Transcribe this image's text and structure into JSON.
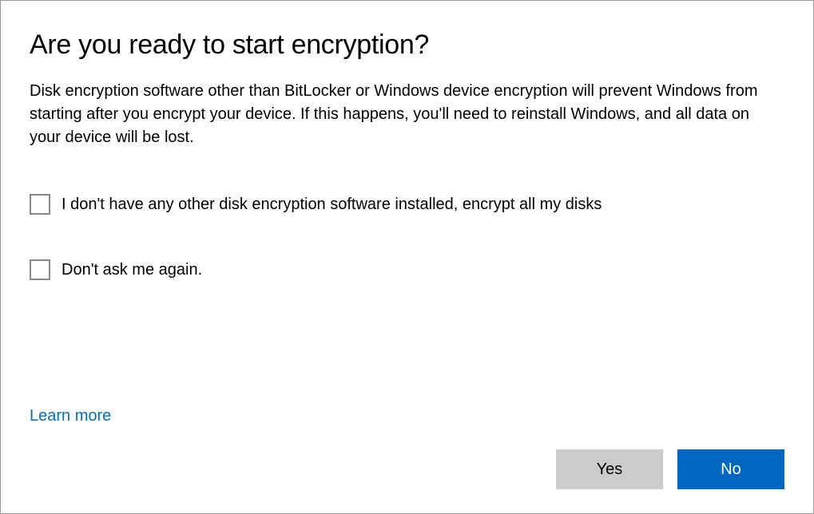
{
  "dialog": {
    "title": "Are you ready to start encryption?",
    "description": "Disk encryption software other than BitLocker or Windows device encryption will prevent Windows from starting after you encrypt your device. If this happens, you'll need to reinstall Windows, and all data on your device will be lost.",
    "checkboxes": [
      {
        "label": "I don't have any other disk encryption software installed, encrypt all my disks",
        "checked": false
      },
      {
        "label": "Don't ask me again.",
        "checked": false
      }
    ],
    "learn_more": "Learn more",
    "buttons": {
      "yes": "Yes",
      "no": "No"
    }
  }
}
